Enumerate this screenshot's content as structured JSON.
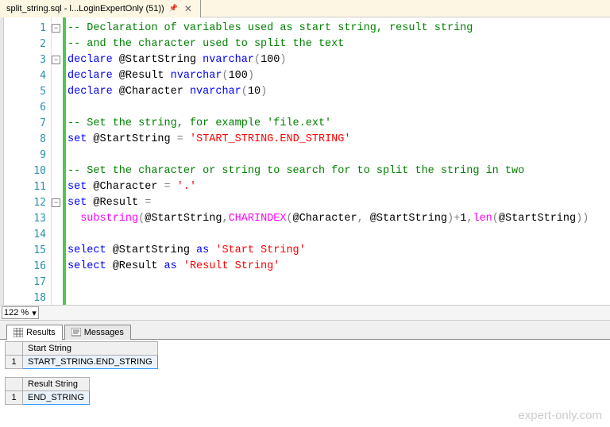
{
  "tab": {
    "title": "split_string.sql - l...LoginExpertOnly (51))"
  },
  "zoom": "122 %",
  "code": {
    "lines": [
      {
        "n": 1,
        "fold": "minus",
        "seg": [
          [
            "comment",
            "-- Declaration of variables used as start string, result string"
          ]
        ]
      },
      {
        "n": 2,
        "seg": [
          [
            "comment",
            "-- and the character used to split the text"
          ]
        ]
      },
      {
        "n": 3,
        "fold": "minus",
        "seg": [
          [
            "keyword",
            "declare"
          ],
          [
            "plain",
            " @StartString "
          ],
          [
            "type",
            "nvarchar"
          ],
          [
            "paren",
            "("
          ],
          [
            "num",
            "100"
          ],
          [
            "paren",
            ")"
          ]
        ]
      },
      {
        "n": 4,
        "seg": [
          [
            "keyword",
            "declare"
          ],
          [
            "plain",
            " @Result "
          ],
          [
            "type",
            "nvarchar"
          ],
          [
            "paren",
            "("
          ],
          [
            "num",
            "100"
          ],
          [
            "paren",
            ")"
          ]
        ]
      },
      {
        "n": 5,
        "seg": [
          [
            "keyword",
            "declare"
          ],
          [
            "plain",
            " @Character "
          ],
          [
            "type",
            "nvarchar"
          ],
          [
            "paren",
            "("
          ],
          [
            "num",
            "10"
          ],
          [
            "paren",
            ")"
          ]
        ]
      },
      {
        "n": 6,
        "seg": []
      },
      {
        "n": 7,
        "seg": [
          [
            "comment",
            "-- Set the string, for example 'file.ext'"
          ]
        ]
      },
      {
        "n": 8,
        "seg": [
          [
            "keyword",
            "set"
          ],
          [
            "plain",
            " @StartString "
          ],
          [
            "paren",
            "="
          ],
          [
            "plain",
            " "
          ],
          [
            "string",
            "'START_STRING.END_STRING'"
          ]
        ]
      },
      {
        "n": 9,
        "seg": []
      },
      {
        "n": 10,
        "seg": [
          [
            "comment",
            "-- Set the character or string to search for to split the string in two"
          ]
        ]
      },
      {
        "n": 11,
        "seg": [
          [
            "keyword",
            "set"
          ],
          [
            "plain",
            " @Character "
          ],
          [
            "paren",
            "="
          ],
          [
            "plain",
            " "
          ],
          [
            "string",
            "'.'"
          ]
        ]
      },
      {
        "n": 12,
        "fold": "minus",
        "seg": [
          [
            "keyword",
            "set"
          ],
          [
            "plain",
            " @Result "
          ],
          [
            "paren",
            "="
          ],
          [
            "plain",
            " "
          ]
        ]
      },
      {
        "n": 13,
        "seg": [
          [
            "plain",
            "  "
          ],
          [
            "func",
            "substring"
          ],
          [
            "paren",
            "("
          ],
          [
            "plain",
            "@StartString"
          ],
          [
            "paren",
            ","
          ],
          [
            "func",
            "CHARINDEX"
          ],
          [
            "paren",
            "("
          ],
          [
            "plain",
            "@Character"
          ],
          [
            "paren",
            ","
          ],
          [
            "plain",
            " @StartString"
          ],
          [
            "paren",
            ")+"
          ],
          [
            "num",
            "1"
          ],
          [
            "paren",
            ","
          ],
          [
            "func",
            "len"
          ],
          [
            "paren",
            "("
          ],
          [
            "plain",
            "@StartString"
          ],
          [
            "paren",
            "))"
          ]
        ]
      },
      {
        "n": 14,
        "seg": []
      },
      {
        "n": 15,
        "seg": [
          [
            "keyword",
            "select"
          ],
          [
            "plain",
            " @StartString "
          ],
          [
            "keyword",
            "as"
          ],
          [
            "plain",
            " "
          ],
          [
            "string",
            "'Start String'"
          ]
        ]
      },
      {
        "n": 16,
        "seg": [
          [
            "keyword",
            "select"
          ],
          [
            "plain",
            " @Result "
          ],
          [
            "keyword",
            "as"
          ],
          [
            "plain",
            " "
          ],
          [
            "string",
            "'Result String'"
          ]
        ]
      },
      {
        "n": 17,
        "seg": []
      },
      {
        "n": 18,
        "seg": []
      }
    ]
  },
  "resultsTabs": {
    "results": "Results",
    "messages": "Messages"
  },
  "grids": [
    {
      "header": "Start String",
      "rownum": "1",
      "value": "START_STRING.END_STRING"
    },
    {
      "header": "Result String",
      "rownum": "1",
      "value": "END_STRING"
    }
  ],
  "watermark": "expert-only.com"
}
